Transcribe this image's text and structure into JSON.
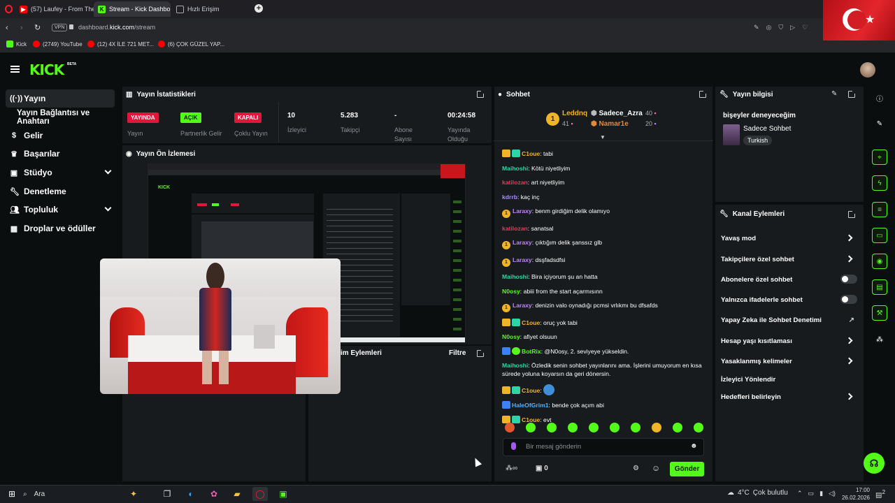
{
  "browser": {
    "tabs": [
      {
        "label": "(57) Laufey - From The",
        "active": false
      },
      {
        "label": "Stream - Kick Dashbo",
        "active": true
      },
      {
        "label": "Hızlı Erişim",
        "active": false
      }
    ],
    "new_tab": "+",
    "vpn": "VPN",
    "url_prefix": "dashboard.",
    "url_domain": "kick.com",
    "url_path": "/stream",
    "bookmarks": [
      {
        "label": "Kick",
        "icon": "kick-icon",
        "color": "#53fc18"
      },
      {
        "label": "(2749) YouTube",
        "icon": "youtube-icon",
        "color": "#ff0000"
      },
      {
        "label": "(12) 4X İLE 721 MET...",
        "icon": "youtube-icon",
        "color": "#ff0000"
      },
      {
        "label": "(6) ÇOK GÜZEL YAP...",
        "icon": "youtube-icon",
        "color": "#ff0000"
      }
    ]
  },
  "header": {
    "logo": "KICK",
    "beta": "BETA"
  },
  "sidebar": {
    "items": [
      {
        "label": "Yayın",
        "icon": "broadcast-icon",
        "selected": true,
        "chevron": false
      },
      {
        "label": "Yayın Bağlantısı ve Anahtarı",
        "icon": "",
        "selected": false,
        "chevron": false
      },
      {
        "label": "Gelir",
        "icon": "money-icon",
        "selected": false,
        "chevron": false
      },
      {
        "label": "Başarılar",
        "icon": "trophy-icon",
        "selected": false,
        "chevron": false
      },
      {
        "label": "Stüdyo",
        "icon": "video-icon",
        "selected": false,
        "chevron": true
      },
      {
        "label": "Denetleme",
        "icon": "wrench-icon",
        "selected": false,
        "chevron": false
      },
      {
        "label": "Topluluk",
        "icon": "users-icon",
        "selected": false,
        "chevron": true
      },
      {
        "label": "Droplar ve ödüller",
        "icon": "gift-icon",
        "selected": false,
        "chevron": false
      }
    ]
  },
  "stats": {
    "title": "Yayın İstatistikleri",
    "items": [
      {
        "badge": "YAYINDA",
        "badge_color": "#e0173b",
        "label": "Yayın"
      },
      {
        "badge": "AÇIK",
        "badge_color": "#53fc18",
        "label": "Partnerlik Gelir"
      },
      {
        "badge": "KAPALI",
        "badge_color": "#e0173b",
        "label": "Çoklu Yayın"
      },
      {
        "value": "10",
        "label": "İzleyici"
      },
      {
        "value": "5.283",
        "label": "Takipçi"
      },
      {
        "value": "-",
        "label": "Abone Sayısı"
      },
      {
        "value": "00:24:58",
        "label": "Yayında Olduğu"
      }
    ]
  },
  "preview": {
    "title": "Yayın Ön İzlemesi"
  },
  "lower_panel": {
    "title": "im Eylemleri",
    "filter": "Filtre"
  },
  "chat": {
    "title": "Sohbet",
    "leaderboard": [
      {
        "rank": "1",
        "name": "Leddnq",
        "count": "41"
      },
      {
        "rank": "",
        "name": "Sadece_Azra",
        "count": "40"
      },
      {
        "rank": "",
        "name": "Namar1e",
        "count": "20"
      }
    ],
    "messages": [
      {
        "user": "C1oue",
        "color": "#f0b429",
        "text": "tabi",
        "badges": "crown"
      },
      {
        "user": "Maihoshi",
        "color": "#2dd4a7",
        "text": "Kötü niyetliyim",
        "badges": ""
      },
      {
        "user": "katilozan",
        "color": "#e0395b",
        "text": "art niyetliyim",
        "badges": ""
      },
      {
        "user": "kdrrb",
        "color": "#a78bfa",
        "text": "kaç inç",
        "badges": ""
      },
      {
        "user": "Laraxy",
        "color": "#c084fc",
        "text": "benm girdiğim delik olamıyo",
        "badges": "coin"
      },
      {
        "user": "katilozan",
        "color": "#e0395b",
        "text": "sanatsal",
        "badges": ""
      },
      {
        "user": "Laraxy",
        "color": "#c084fc",
        "text": "çıktığım delik şanssız glb",
        "badges": "coin"
      },
      {
        "user": "Laraxy",
        "color": "#c084fc",
        "text": "dsşfadsdfsi",
        "badges": "coin"
      },
      {
        "user": "Maihoshi",
        "color": "#2dd4a7",
        "text": "Bira içiyorum şu an hatta",
        "badges": ""
      },
      {
        "user": "N0osy",
        "color": "#53fc18",
        "text": "abiii from the start açarmısınn",
        "badges": ""
      },
      {
        "user": "Laraxy",
        "color": "#c084fc",
        "text": "denizin valo oynadığı pcmsi vrlıkmı bu dfsafds",
        "badges": "coin"
      },
      {
        "user": "C1oue",
        "color": "#f0b429",
        "text": "oruç yok tabi",
        "badges": "crown"
      },
      {
        "user": "N0osy",
        "color": "#53fc18",
        "text": "afiyet olsuun",
        "badges": ""
      },
      {
        "user": "BotRix",
        "color": "#53fc18",
        "text": "@N0osy, 2. seviyeye yükseldin.",
        "badges": "bot"
      },
      {
        "user": "Maihoshi",
        "color": "#2dd4a7",
        "text": "Özledik senin sohbet yayınlarını ama. İşlerini umuyorum en kısa sürede yoluna koyarsın da geri dönersin.",
        "badges": ""
      },
      {
        "user": "C1oue",
        "color": "#f0b429",
        "text": "",
        "badges": "crown"
      },
      {
        "user": "HaleOfGrim1",
        "color": "#4fb3ff",
        "text": "bende çok açım abi",
        "badges": "pencil"
      },
      {
        "user": "C1oue",
        "color": "#f0b429",
        "text": "evt",
        "badges": "crown"
      }
    ],
    "input_placeholder": "Bir mesaj gönderin",
    "points": "0",
    "send": "Gönder"
  },
  "stream_info": {
    "title": "Yayın bilgisi",
    "stream_title": "bişeyler deneyeceğim",
    "category": "Sadece Sohbet",
    "language": "Turkish"
  },
  "channel_actions": {
    "title": "Kanal Eylemleri",
    "items": [
      {
        "label": "Yavaş mod",
        "type": "chevron"
      },
      {
        "label": "Takipçilere özel sohbet",
        "type": "chevron"
      },
      {
        "label": "Abonelere özel sohbet",
        "type": "toggle"
      },
      {
        "label": "Yalnızca ifadelerle sohbet",
        "type": "toggle"
      },
      {
        "label": "Yapay Zeka ile Sohbet Denetimi",
        "type": "external"
      },
      {
        "label": "Hesap yaşı kısıtlaması",
        "type": "chevron"
      },
      {
        "label": "Yasaklanmış kelimeler",
        "type": "chevron"
      },
      {
        "label": "İzleyici Yönlendir",
        "type": "none"
      },
      {
        "label": "Hedefleri belirleyin",
        "type": "chevron"
      }
    ]
  },
  "taskbar": {
    "search": "Ara",
    "weather": "4°C",
    "weather_text": "Çok bulutlu",
    "time": "17:00",
    "date": "26.02.2026",
    "notifications": "2"
  }
}
